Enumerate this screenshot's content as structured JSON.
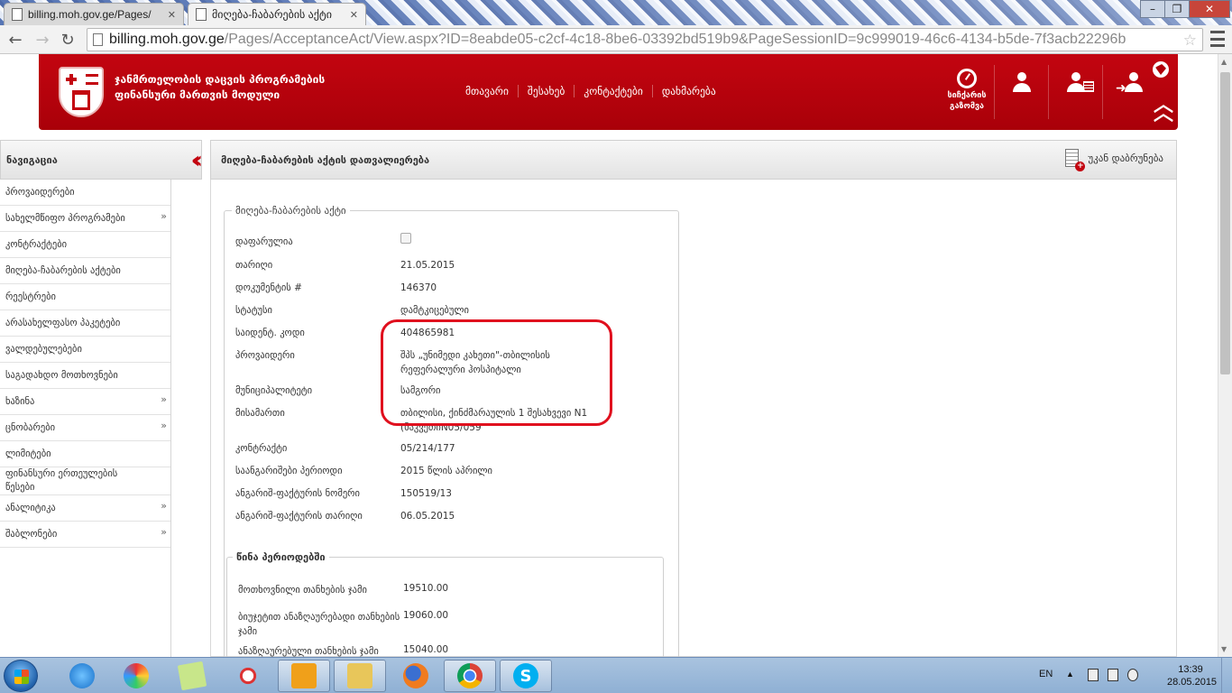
{
  "browser": {
    "tabs": [
      {
        "label": "billing.moh.gov.ge/Pages/"
      },
      {
        "label": "მიღება-ჩაბარების აქტი"
      }
    ],
    "address": {
      "host": "billing.moh.gov.ge",
      "path": "/Pages/AcceptanceAct/View.aspx?ID=8eabde05-c2cf-4c18-8be6-03392bd519b9&PageSessionID=9c999019-46c6-4134-b5de-7f3acb22296b"
    }
  },
  "header": {
    "org_title_line1": "ჯანმრთელობის დაცვის პროგრამების",
    "org_title_line2": "ფინანსური მართვის მოდული",
    "nav": [
      {
        "label": "მთავარი"
      },
      {
        "label": "შესახებ"
      },
      {
        "label": "კონტაქტები"
      },
      {
        "label": "დახმარება"
      }
    ],
    "speed_label_line1": "სიჩქარის",
    "speed_label_line2": "გაზომვა"
  },
  "sidebar": {
    "title": "ნავიგაცია",
    "items": [
      {
        "label": "პროვაიდერები",
        "has_children": false
      },
      {
        "label": "სახელმწიფო პროგრამები",
        "has_children": true
      },
      {
        "label": "კონტრაქტები",
        "has_children": false
      },
      {
        "label": "მიღება-ჩაბარების აქტები",
        "has_children": false
      },
      {
        "label": "რეესტრები",
        "has_children": false
      },
      {
        "label": "არასახელფასო პაკეტები",
        "has_children": false
      },
      {
        "label": "ვალდებულებები",
        "has_children": false
      },
      {
        "label": "საგადახდო მოთხოვნები",
        "has_children": false
      },
      {
        "label": "ხაზინა",
        "has_children": true
      },
      {
        "label": "ცნობარები",
        "has_children": true
      },
      {
        "label": "ლიმიტები",
        "has_children": false
      },
      {
        "label": "ფინანსური ერთეულების წესები",
        "has_children": false
      },
      {
        "label": "ანალიტიკა",
        "has_children": true
      },
      {
        "label": "შაბლონები",
        "has_children": true
      }
    ]
  },
  "main": {
    "title": "მიღება-ჩაბარების აქტის დათვალიერება",
    "back_label": "უკან დაბრუნება",
    "act_legend": "მიღება-ჩაბარების აქტი",
    "fields": {
      "hidden_label": "დაფარულია",
      "hidden_checked": false,
      "date_label": "თარიღი",
      "date_value": "21.05.2015",
      "doc_label": "დოკუმენტის #",
      "doc_value": "146370",
      "status_label": "სტატუსი",
      "status_value": "დამტკიცებული",
      "tax_id_label": "საიდენტ. კოდი",
      "tax_id_value": "404865981",
      "provider_label": "პროვაიდერი",
      "provider_value": "შპს „უნიმედი კახეთი\"-თბილისის რეფერალური ჰოსპიტალი",
      "municipality_label": "მუნიციპალიტეტი",
      "municipality_value": "სამგორი",
      "address_label": "მისამართი",
      "address_value": "თბილისი, ქინძმარაულის 1 შესახვევი N1 (ნაკვეთიN05/059",
      "contract_label": "კონტრაქტი",
      "contract_value": "05/214/177",
      "period_label": "საანგარიშები პერიოდი",
      "period_value": "2015 წლის აპრილი",
      "invoice_no_label": "ანგარიშ-ფაქტურის ნომერი",
      "invoice_no_value": "150519/13",
      "invoice_date_label": "ანგარიშ-ფაქტურის თარიღი",
      "invoice_date_value": "06.05.2015"
    },
    "previous": {
      "legend": "წინა პერიოდებში",
      "requested_label": "მოთხოვნილი თანხების ჯამი",
      "requested_value": "19510.00",
      "budget_label": "ბიუჯეტით ანაზღაურებადი თანხების ჯამი",
      "budget_value": "19060.00",
      "paid_label": "ანაზღაურებული თანხების ჯამი",
      "paid_value": "15040.00"
    }
  },
  "taskbar": {
    "language": "EN",
    "time": "13:39",
    "date": "28.05.2015"
  },
  "colors": {
    "brand_red": "#c30510",
    "highlight_red": "#e0101e"
  }
}
